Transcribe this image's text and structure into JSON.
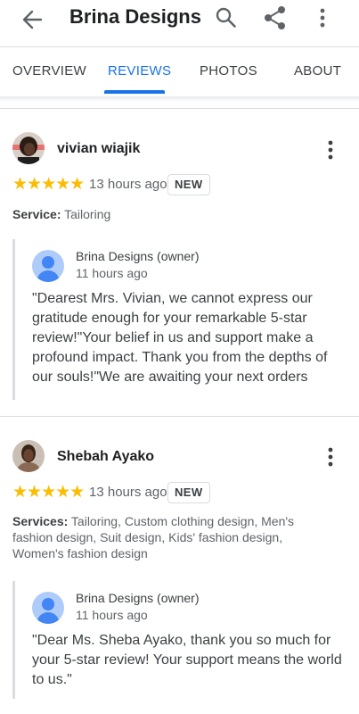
{
  "appbar": {
    "title": "Brina Designs"
  },
  "tabs": [
    {
      "label": "OVERVIEW",
      "active": false
    },
    {
      "label": "REVIEWS",
      "active": true
    },
    {
      "label": "PHOTOS",
      "active": false
    },
    {
      "label": "ABOUT",
      "active": false
    }
  ],
  "colors": {
    "accent": "#1a73e8",
    "star": "#fbbc04"
  },
  "reviews": [
    {
      "name": "vivian wiajik",
      "rating": 5,
      "stars": "★★★★★",
      "time": "13 hours ago",
      "badge": "NEW",
      "service_label": "Service:",
      "service_value": "Tailoring",
      "reply": {
        "owner": "Brina Designs (owner)",
        "time": "11 hours ago",
        "text": "\"Dearest Mrs. Vivian, we cannot express our gratitude enough for your remarkable 5-star review!\"Your belief in us and support make a profound impact. Thank you from the depths of our souls!\"We are awaiting your next orders"
      }
    },
    {
      "name": "Shebah Ayako",
      "rating": 5,
      "stars": "★★★★★",
      "time": "13 hours ago",
      "badge": "NEW",
      "service_label": "Services:",
      "service_value": "Tailoring, Custom clothing design, Men's fashion design, Suit design, Kids' fashion design, Women's fashion design",
      "reply": {
        "owner": "Brina Designs (owner)",
        "time": "11 hours ago",
        "text": "\"Dear Ms. Sheba Ayako, thank you so much for your 5-star review! Your support means the world to us.\""
      }
    }
  ]
}
